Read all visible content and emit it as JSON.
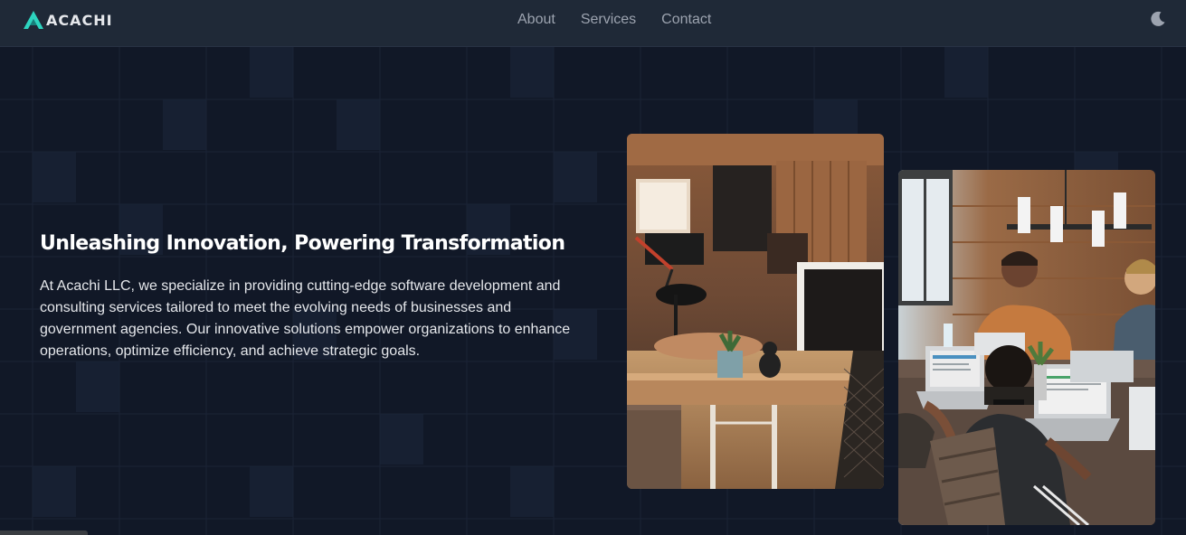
{
  "brand": {
    "name": "ACACHI",
    "logo_icon": "acachi-logo-icon"
  },
  "nav": {
    "links": [
      {
        "label": "About"
      },
      {
        "label": "Services"
      },
      {
        "label": "Contact"
      }
    ],
    "theme_toggle_icon": "moon-icon"
  },
  "hero": {
    "title": "Unleashing Innovation, Powering Transformation",
    "body": "At Acachi LLC, we specialize in providing cutting-edge software development and consulting services tailored to meet the evolving needs of businesses and government agencies. Our innovative solutions empower organizations to enhance operations, optimize efficiency, and achieve strategic goals.",
    "images": [
      {
        "name": "office-workspace-photo"
      },
      {
        "name": "team-working-laptops-photo"
      }
    ]
  },
  "colors": {
    "background": "#111827",
    "nav_background": "#1f2937",
    "accent": "#2dd4bf",
    "text": "#ffffff",
    "muted_text": "#9ca3af"
  }
}
